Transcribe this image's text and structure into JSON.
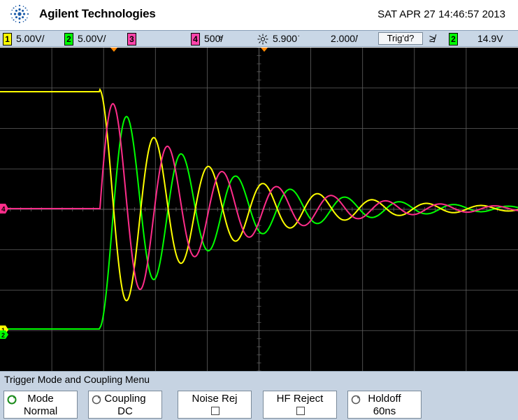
{
  "header": {
    "brand": "Agilent Technologies",
    "datetime": "SAT APR 27 14:46:57 2013"
  },
  "status": {
    "ch1_num": "1",
    "ch1_scale": "5.00V/",
    "ch2_num": "2",
    "ch2_scale": "5.00V/",
    "ch3_num": "3",
    "ch4_num": "4",
    "ch4_scale": "500ͤ/",
    "delay": "5.900͘",
    "timebase": "2.000͘/",
    "trig_label": "Trig'd?",
    "trig_slope": "≱",
    "trig_src": "2",
    "trig_level": "14.9V"
  },
  "markers": {
    "ch4_marker": "4",
    "ch1_marker": "1",
    "ch2_marker": "2"
  },
  "menu": {
    "title": "Trigger Mode and Coupling Menu",
    "mode_label": "Mode",
    "mode_value": "Normal",
    "coupling_label": "Coupling",
    "coupling_value": "DC",
    "noise_label": "Noise Rej",
    "hf_label": "HF Reject",
    "holdoff_label": "Holdoff",
    "holdoff_value": "60ns"
  },
  "colors": {
    "ch1": "#ffff00",
    "ch2": "#00ff00",
    "ch3": "#ff2d8a",
    "grid": "#606060",
    "background": "#000000"
  }
}
